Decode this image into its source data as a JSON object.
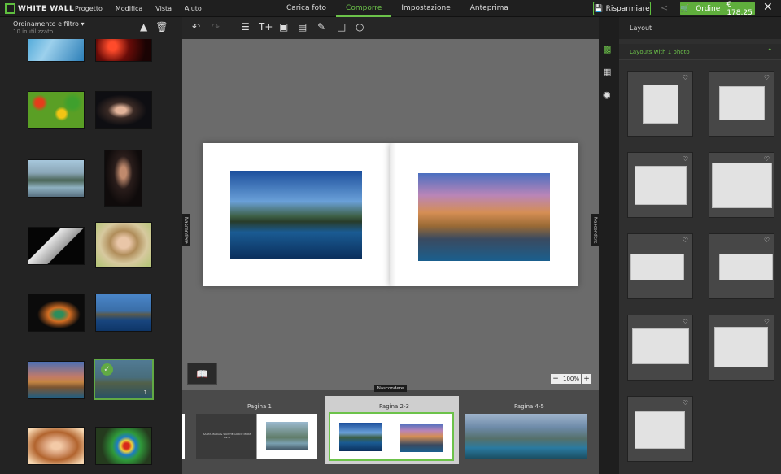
{
  "brand": {
    "logo_text": "WHITE WALL",
    "accent": "#6cc24a"
  },
  "menu": [
    "Progetto",
    "Modifica",
    "Vista",
    "Aiuto"
  ],
  "tabs": [
    {
      "label": "Carica foto",
      "active": false
    },
    {
      "label": "Comporre",
      "active": true
    },
    {
      "label": "Impostazione",
      "active": false
    },
    {
      "label": "Anteprima",
      "active": false
    }
  ],
  "header": {
    "save_label": "Risparmiare",
    "order_label": "Ordine",
    "order_price": "€ 178,25"
  },
  "left": {
    "sort_label": "Ordinamento e filtro",
    "sort_sub": "10 inutilizzato",
    "selected_badge": "1"
  },
  "canvas": {
    "hide_label": "Nascondere",
    "zoom": "100%"
  },
  "strip": {
    "hide_label": "Nascondere",
    "pages": [
      "Pagina 1",
      "Pagina 2-3",
      "Pagina 4-5"
    ],
    "page1_caption": "SANTA MARIA & SANTHE GORDE MORE ENTS"
  },
  "right": {
    "title": "Layout",
    "section": "Layouts with 1 photo"
  }
}
